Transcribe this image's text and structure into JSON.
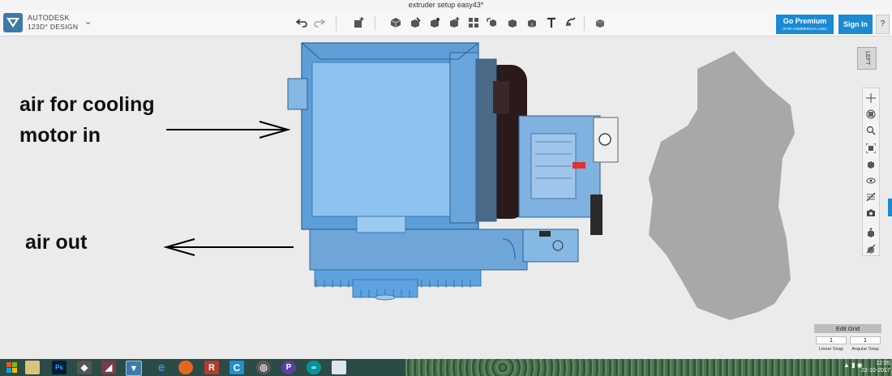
{
  "window": {
    "title": "extruder setup easy43*"
  },
  "brand": {
    "line1": "AUTODESK",
    "line2": "123D° DESIGN"
  },
  "header": {
    "premium_label": "Go Premium",
    "premium_sub": "(FOR COMMERCIAL USE)",
    "signin_label": "Sign In",
    "help_label": "?"
  },
  "toolbar": {
    "icons": [
      "undo-icon",
      "redo-icon",
      "transform-icon",
      "primitives-icon",
      "sketch-icon",
      "construct-icon",
      "modify-icon",
      "pattern-icon",
      "group-icon",
      "combine-icon",
      "measure-icon",
      "text-icon",
      "snap-icon",
      "material-icon"
    ]
  },
  "annotations": {
    "line1": "air for cooling",
    "line2": "motor in",
    "line3": "air out"
  },
  "viewcube": {
    "label": "LEFT"
  },
  "grid": {
    "title": "Edit Grid",
    "linear_value": "1",
    "angular_value": "1",
    "linear_label": "Linear Snap",
    "angular_label": "Angular Snap"
  },
  "taskbar": {
    "time": "12:55",
    "date": "22-10-2017"
  },
  "colors": {
    "accent": "#1a8ad4",
    "model_blue": "#5a9bd5",
    "motor_dark": "#2a1a1a"
  }
}
